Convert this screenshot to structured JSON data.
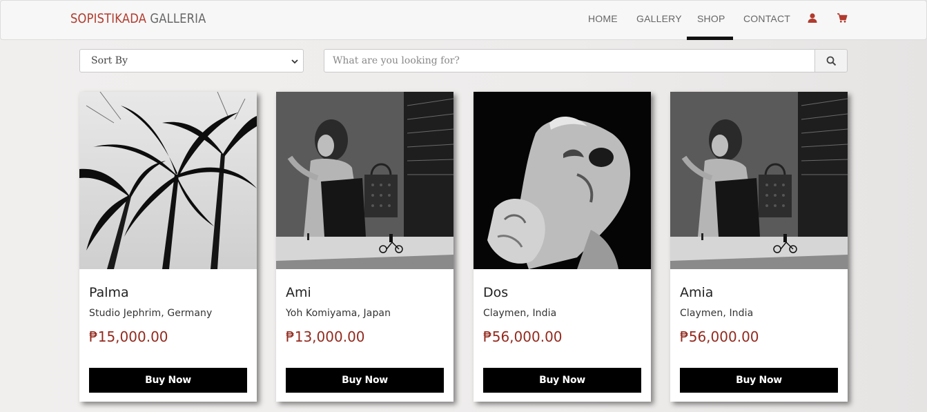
{
  "brand": {
    "part1": "SOPISTIKADA",
    "part2": " GALLERIA"
  },
  "nav": {
    "items": [
      {
        "label": "HOME"
      },
      {
        "label": "GALLERY"
      },
      {
        "label": "SHOP"
      },
      {
        "label": "CONTACT"
      }
    ],
    "active": "SHOP",
    "icons": [
      "user-icon",
      "cart-icon"
    ]
  },
  "controls": {
    "sort_label": "Sort By",
    "search_placeholder": "What are you looking for?"
  },
  "products": [
    {
      "title": "Palma",
      "artist": "Studio Jephrim, Germany",
      "price": "₱15,000.00",
      "button": "Buy Now",
      "image": "palm-trees-photo"
    },
    {
      "title": "Ami",
      "artist": "Yoh Komiyama, Japan",
      "price": "₱13,000.00",
      "button": "Buy Now",
      "image": "woman-billboard-photo"
    },
    {
      "title": "Dos",
      "artist": "Claymen, India",
      "price": "₱56,000.00",
      "button": "Buy Now",
      "image": "screaming-sculpture-photo"
    },
    {
      "title": "Amia",
      "artist": "Claymen, India",
      "price": "₱56,000.00",
      "button": "Buy Now",
      "image": "woman-billboard-photo"
    }
  ],
  "colors": {
    "brand_red": "#b13b2e",
    "price_red": "#922a1e",
    "button_black": "#000000"
  }
}
